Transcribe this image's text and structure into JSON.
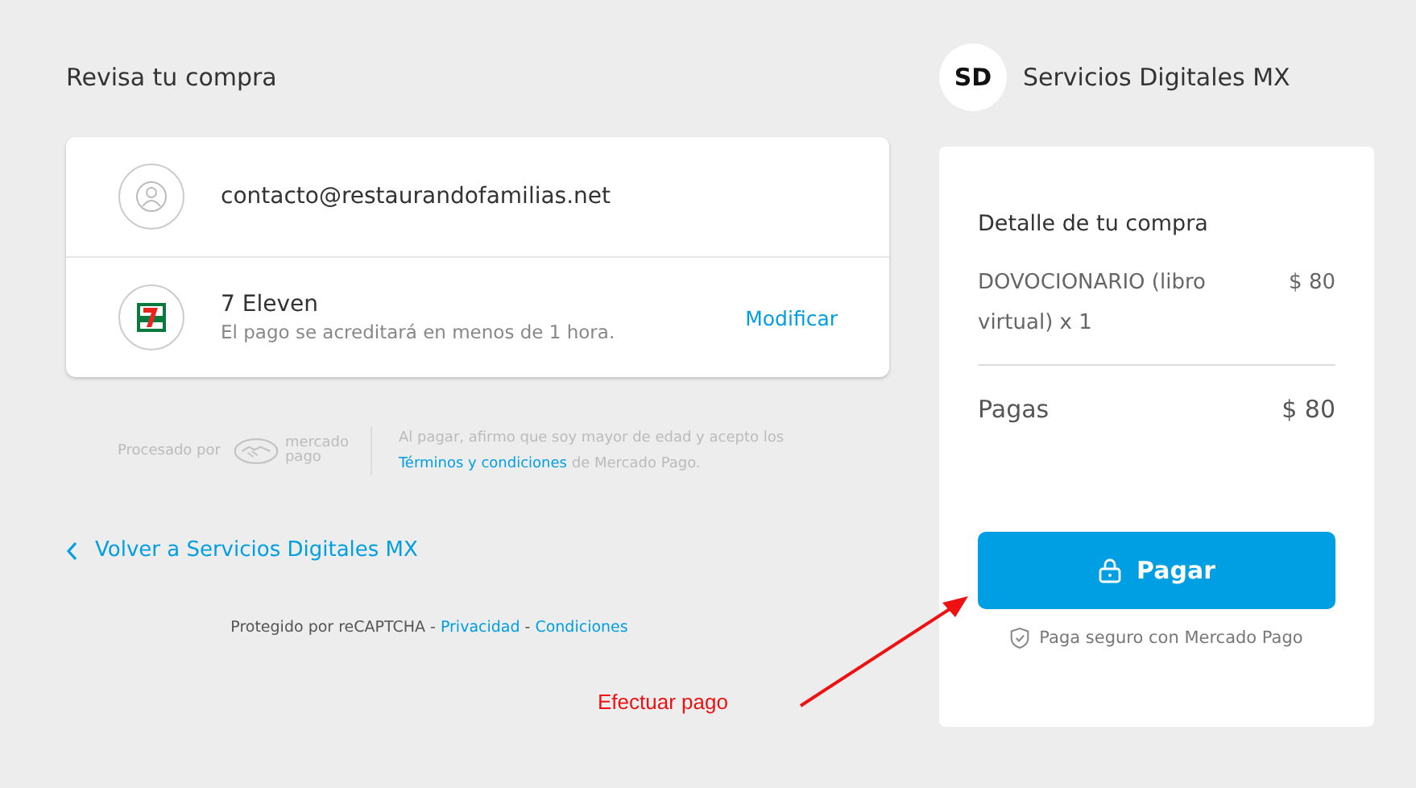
{
  "left": {
    "title": "Revisa tu compra",
    "contact": {
      "email": "contacto@restaurandofamilias.net"
    },
    "payment": {
      "name": "7 Eleven",
      "note": "El pago se acreditará en menos de 1 hora.",
      "action": "Modificar"
    },
    "legal": {
      "processed_by": "Procesado por",
      "logo_top": "mercado",
      "logo_bottom": "pago",
      "text_before": "Al pagar, afirmo que soy mayor de edad y acepto los",
      "link": "Términos y condiciones",
      "text_after": "de Mercado Pago."
    },
    "back_link": "Volver a Servicios Digitales MX",
    "recaptcha": {
      "text": "Protegido por reCAPTCHA -",
      "privacy": "Privacidad",
      "separator": "-",
      "terms": "Condiciones"
    }
  },
  "right": {
    "seller": {
      "logo": "SD",
      "name": "Servicios Digitales MX"
    },
    "summary": {
      "title": "Detalle de tu compra",
      "items": [
        {
          "name": "DOVOCIONARIO (libro virtual) x 1",
          "price": "$ 80"
        }
      ],
      "total_label": "Pagas",
      "total": "$ 80"
    },
    "pay_button": "Pagar",
    "secure_note": "Paga seguro con Mercado Pago"
  },
  "annotation": {
    "text": "Efectuar pago"
  }
}
